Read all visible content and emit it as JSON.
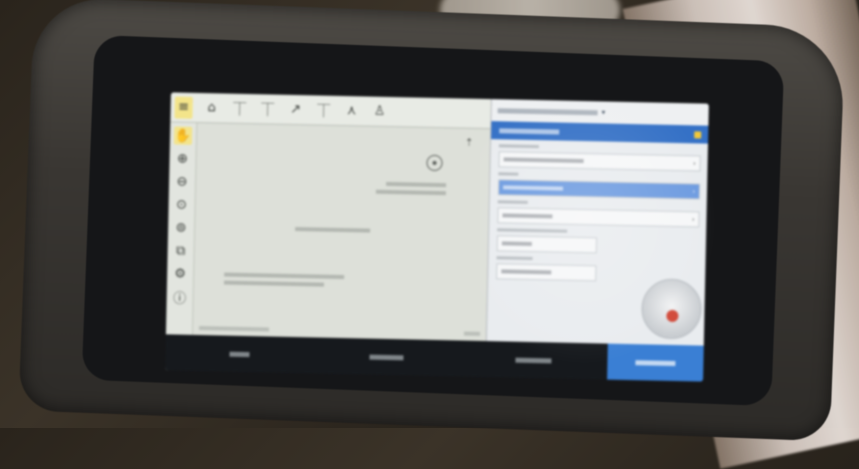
{
  "background": {
    "pipe_color": "#e9e0d8",
    "surface_color": "#2f2920"
  },
  "device": {
    "body_color": "#3d3a36",
    "screen_color": "#d9ddd5",
    "accent_color": "#3a7fd4"
  },
  "toolbar": {
    "icons": [
      "menu-icon",
      "survey-icon",
      "rod-icon",
      "rod-icon",
      "rover-icon",
      "rod-icon",
      "tripod-icon",
      "person-icon"
    ]
  },
  "left_toolbar": {
    "icons": [
      "pan-icon",
      "zoom-in-icon",
      "zoom-out-icon",
      "zoom-extents-icon",
      "layers-icon",
      "settings-icon"
    ]
  },
  "right_panel": {
    "mode_color": "#3571c6"
  },
  "softkeys": {
    "accent": "#3a7fd4"
  }
}
